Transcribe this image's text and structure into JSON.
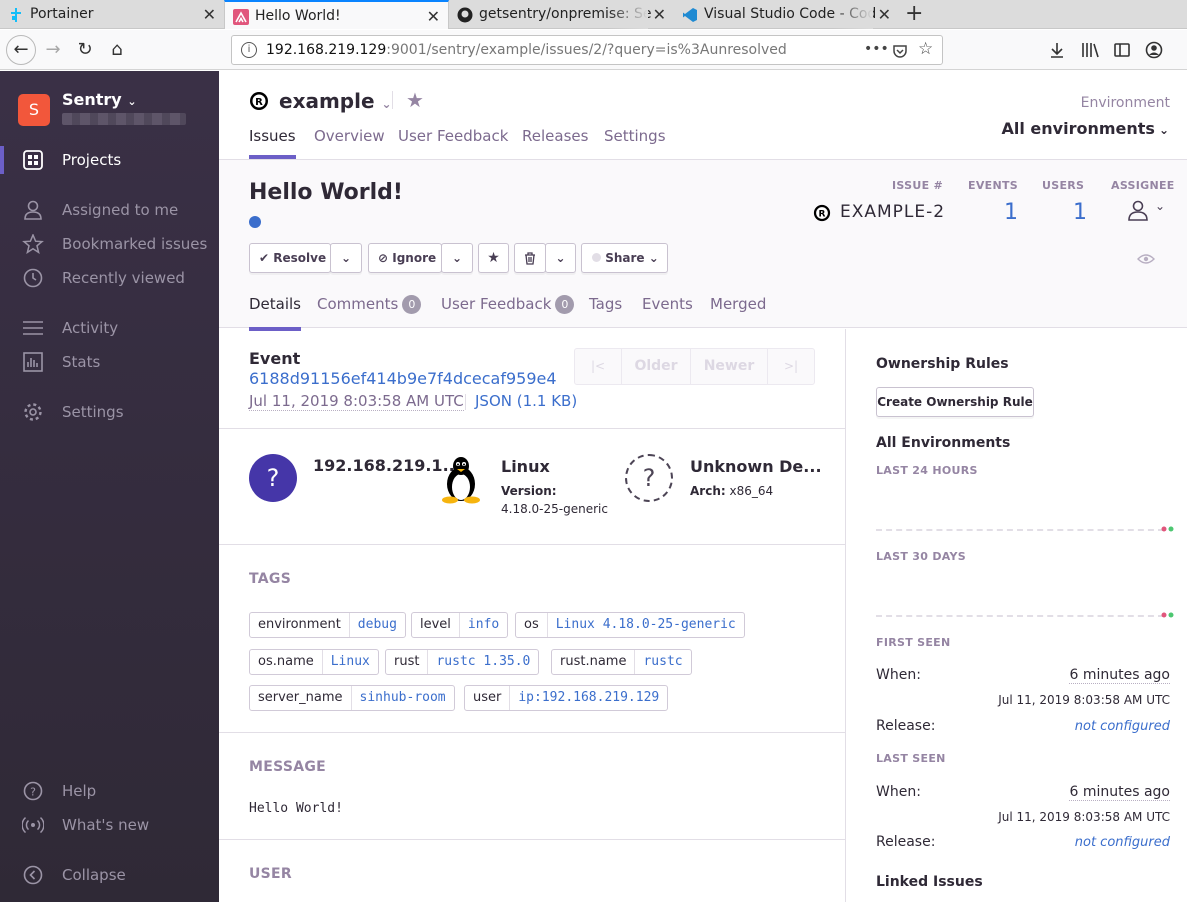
{
  "browser": {
    "tabs": [
      {
        "title": "Portainer",
        "icon": "portainer-icon",
        "active": false
      },
      {
        "title": "Hello World!",
        "icon": "sentry-icon",
        "active": true
      },
      {
        "title": "getsentry/onpremise: Se",
        "icon": "github-icon",
        "active": false
      },
      {
        "title": "Visual Studio Code - Cod",
        "icon": "vscode-icon",
        "active": false
      }
    ],
    "new_tab": "+",
    "url_host": "192.168.219.129",
    "url_rest": ":9001/sentry/example/issues/2/?query=is%3Aunresolved",
    "url_more": "•••"
  },
  "sidebar": {
    "org_initial": "S",
    "org_name": "Sentry",
    "items": [
      {
        "label": "Projects",
        "icon": "projects-icon",
        "active": true
      },
      {
        "label": "Assigned to me",
        "icon": "user-icon"
      },
      {
        "label": "Bookmarked issues",
        "icon": "star-icon"
      },
      {
        "label": "Recently viewed",
        "icon": "clock-icon"
      },
      {
        "label": "Activity",
        "icon": "activity-icon"
      },
      {
        "label": "Stats",
        "icon": "stats-icon"
      },
      {
        "label": "Settings",
        "icon": "gear-icon"
      }
    ],
    "bottom": [
      {
        "label": "Help",
        "icon": "help-icon"
      },
      {
        "label": "What's new",
        "icon": "broadcast-icon"
      },
      {
        "label": "Collapse",
        "icon": "collapse-icon"
      }
    ]
  },
  "header": {
    "project": "example",
    "tabs": [
      "Issues",
      "Overview",
      "User Feedback",
      "Releases",
      "Settings"
    ],
    "env_label": "Environment",
    "env_value": "All environments"
  },
  "issue": {
    "title": "Hello World!",
    "stats_labels": {
      "issue": "ISSUE #",
      "events": "EVENTS",
      "users": "USERS",
      "assignee": "ASSIGNEE"
    },
    "issue_id": "EXAMPLE-2",
    "events": "1",
    "users": "1",
    "actions": {
      "resolve": "Resolve",
      "ignore": "Ignore",
      "share": "Share"
    },
    "subtabs": [
      {
        "label": "Details"
      },
      {
        "label": "Comments",
        "badge": "0"
      },
      {
        "label": "User Feedback",
        "badge": "0"
      },
      {
        "label": "Tags"
      },
      {
        "label": "Events"
      },
      {
        "label": "Merged"
      }
    ]
  },
  "event": {
    "label": "Event",
    "id": "6188d91156ef414b9e7f4dcecaf959e4",
    "date": "Jul 11, 2019 8:03:58 AM UTC",
    "json": "JSON (1.1 KB)",
    "pager": [
      "Older",
      "Newer"
    ]
  },
  "context": {
    "user": {
      "title": "192.168.219.1..."
    },
    "os": {
      "title": "Linux",
      "version_label": "Version:",
      "version": "4.18.0-25-generic"
    },
    "device": {
      "title": "Unknown De...",
      "arch_label": "Arch:",
      "arch": "x86_64"
    }
  },
  "tags_title": "TAGS",
  "tags": [
    {
      "key": "environment",
      "value": "debug"
    },
    {
      "key": "level",
      "value": "info"
    },
    {
      "key": "os",
      "value": "Linux 4.18.0-25-generic"
    },
    {
      "key": "os.name",
      "value": "Linux"
    },
    {
      "key": "rust",
      "value": "rustc 1.35.0"
    },
    {
      "key": "rust.name",
      "value": "rustc"
    },
    {
      "key": "server_name",
      "value": "sinhub-room"
    },
    {
      "key": "user",
      "value": "ip:192.168.219.129"
    }
  ],
  "message": {
    "title": "MESSAGE",
    "text": "Hello World!"
  },
  "user_section": {
    "title": "USER"
  },
  "sidebar_right": {
    "ownership_title": "Ownership Rules",
    "ownership_button": "Create Ownership Rule",
    "all_env": "All Environments",
    "last24": "LAST 24 HOURS",
    "last30": "LAST 30 DAYS",
    "first_seen": "FIRST SEEN",
    "last_seen": "LAST SEEN",
    "when_label": "When:",
    "release_label": "Release:",
    "first_when": "6 minutes ago",
    "first_date": "Jul 11, 2019 8:03:58 AM UTC",
    "first_release": "not configured",
    "last_when": "6 minutes ago",
    "last_date": "Jul 11, 2019 8:03:58 AM UTC",
    "last_release": "not configured",
    "linked": "Linked Issues"
  },
  "colors": {
    "accent": "#6c5fc7",
    "sidebar": "#2f2936",
    "link": "#3b6ecc",
    "avatar": "#f2573b",
    "user_avatar": "#4536a8"
  }
}
